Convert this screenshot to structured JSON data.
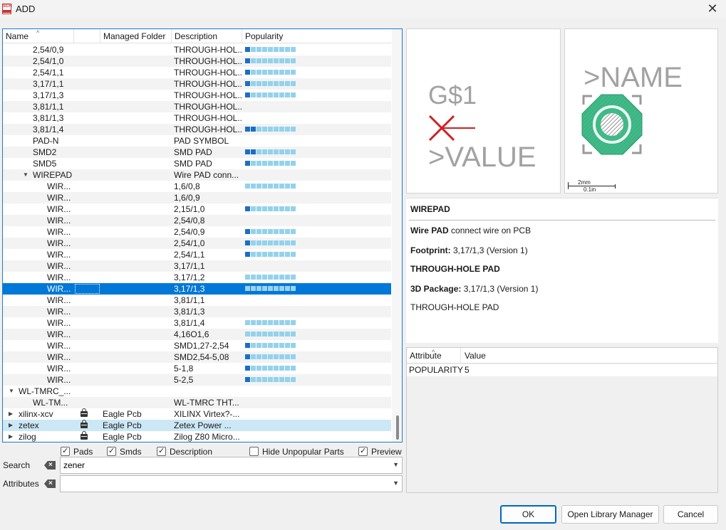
{
  "window": {
    "title": "ADD",
    "app_icon_text": "SCH",
    "close_icon": "close-icon"
  },
  "tree": {
    "columns": {
      "name": "Name",
      "managed_folder": "Managed Folder",
      "description": "Description",
      "popularity": "Popularity"
    },
    "rows": [
      {
        "name": "2,54/0,9",
        "indent": 42,
        "desc": "THROUGH-HOL...",
        "pop": 1
      },
      {
        "name": "2,54/1,0",
        "indent": 42,
        "desc": "THROUGH-HOL...",
        "pop": 1
      },
      {
        "name": "2,54/1,1",
        "indent": 42,
        "desc": "THROUGH-HOL...",
        "pop": 1
      },
      {
        "name": "3,17/1,1",
        "indent": 42,
        "desc": "THROUGH-HOL...",
        "pop": 1
      },
      {
        "name": "3,17/1,3",
        "indent": 42,
        "desc": "THROUGH-HOL...",
        "pop": 1
      },
      {
        "name": "3,81/1,1",
        "indent": 42,
        "desc": "THROUGH-HOL...",
        "pop": 0
      },
      {
        "name": "3,81/1,3",
        "indent": 42,
        "desc": "THROUGH-HOL...",
        "pop": 0
      },
      {
        "name": "3,81/1,4",
        "indent": 42,
        "desc": "THROUGH-HOL...",
        "pop": 2
      },
      {
        "name": "PAD-N",
        "indent": 42,
        "desc": "PAD SYMBOL",
        "pop": 0
      },
      {
        "name": "SMD2",
        "indent": 42,
        "desc": "SMD PAD",
        "pop": 2
      },
      {
        "name": "SMD5",
        "indent": 42,
        "desc": "SMD PAD",
        "pop": 1
      },
      {
        "name": "WIREPAD",
        "indent": 42,
        "desc": "Wire PAD conn...",
        "pop": 0,
        "expanded": true
      },
      {
        "name": "WIR...",
        "indent": 62,
        "desc": "1,6/0,8",
        "pop": 0,
        "bar": true
      },
      {
        "name": "WIR...",
        "indent": 62,
        "desc": "1,6/0,9",
        "pop": 0
      },
      {
        "name": "WIR...",
        "indent": 62,
        "desc": "2,15/1,0",
        "pop": 1
      },
      {
        "name": "WIR...",
        "indent": 62,
        "desc": "2,54/0,8",
        "pop": 0
      },
      {
        "name": "WIR...",
        "indent": 62,
        "desc": "2,54/0,9",
        "pop": 1
      },
      {
        "name": "WIR...",
        "indent": 62,
        "desc": "2,54/1,0",
        "pop": 1
      },
      {
        "name": "WIR...",
        "indent": 62,
        "desc": "2,54/1,1",
        "pop": 1
      },
      {
        "name": "WIR...",
        "indent": 62,
        "desc": "3,17/1,1",
        "pop": 0
      },
      {
        "name": "WIR...",
        "indent": 62,
        "desc": "3,17/1,2",
        "pop": 0,
        "bar": true
      },
      {
        "name": "WIR...",
        "indent": 62,
        "desc": "3,17/1,3",
        "pop": 0,
        "bar": true,
        "selected": true
      },
      {
        "name": "WIR...",
        "indent": 62,
        "desc": "3,81/1,1",
        "pop": 0
      },
      {
        "name": "WIR...",
        "indent": 62,
        "desc": "3,81/1,3",
        "pop": 0
      },
      {
        "name": "WIR...",
        "indent": 62,
        "desc": "3,81/1,4",
        "pop": 0,
        "bar": true
      },
      {
        "name": "WIR...",
        "indent": 62,
        "desc": "4,16O1,6",
        "pop": 0,
        "bar": true
      },
      {
        "name": "WIR...",
        "indent": 62,
        "desc": "SMD1,27-2,54",
        "pop": 1
      },
      {
        "name": "WIR...",
        "indent": 62,
        "desc": "SMD2,54-5,08",
        "pop": 1
      },
      {
        "name": "WIR...",
        "indent": 62,
        "desc": "5-1,8",
        "pop": 1
      },
      {
        "name": "WIR...",
        "indent": 62,
        "desc": "5-2,5",
        "pop": 1
      },
      {
        "name": "WL-TMRC_...",
        "indent": 22,
        "desc": "",
        "pop": 0,
        "expanded": true
      },
      {
        "name": "WL-TM...",
        "indent": 42,
        "desc": "WL-TMRC THT...",
        "pop": 0
      },
      {
        "name": "xilinx-xcv",
        "indent": 22,
        "desc": "XILINX Virtex?-...",
        "mf": "Eagle Pcb",
        "lock": true,
        "collapsed": true
      },
      {
        "name": "zetex",
        "indent": 22,
        "desc": "Zetex Power ...",
        "mf": "Eagle Pcb",
        "lock": true,
        "collapsed": true,
        "hover": true
      },
      {
        "name": "zilog",
        "indent": 22,
        "desc": "Zilog Z80 Micro...",
        "mf": "Eagle Pcb",
        "lock": true,
        "collapsed": true
      }
    ]
  },
  "options": {
    "pads": {
      "label": "Pads",
      "checked": true
    },
    "smds": {
      "label": "Smds",
      "checked": true
    },
    "description": {
      "label": "Description",
      "checked": true
    },
    "hide_unpopular": {
      "label": "Hide Unpopular Parts",
      "checked": false
    },
    "preview": {
      "label": "Preview",
      "checked": true
    }
  },
  "search": {
    "label": "Search",
    "value": "zener"
  },
  "attributes": {
    "label": "Attributes",
    "value": ""
  },
  "symbol_preview": {
    "name_text": "G$1",
    "value_text": ">VALUE"
  },
  "package_preview": {
    "name_text": ">NAME",
    "scale_mm": "2mm",
    "scale_in": "0.1in"
  },
  "description": {
    "title": "WIREPAD",
    "line1_bold": "Wire PAD",
    "line1_rest": " connect wire on PCB",
    "footprint_label": "Footprint:",
    "footprint_value": " 3,17/1,3 (Version 1)",
    "through_hole_bold": "THROUGH-HOLE PAD",
    "package_label": "3D Package:",
    "package_value": " 3,17/1,3 (Version 1)",
    "through_hole_plain": "THROUGH-HOLE PAD"
  },
  "attribute_table": {
    "col_attribute": "Attribute",
    "col_value": "Value",
    "rows": [
      {
        "attribute": "POPULARITY",
        "value": "5"
      }
    ]
  },
  "buttons": {
    "ok": "OK",
    "open_library_manager": "Open Library Manager",
    "cancel": "Cancel"
  },
  "colors": {
    "accent": "#0078d7",
    "pop_on": "#1a6fc4",
    "pop_off": "#93d2ec",
    "pad_green": "#3fba88"
  }
}
